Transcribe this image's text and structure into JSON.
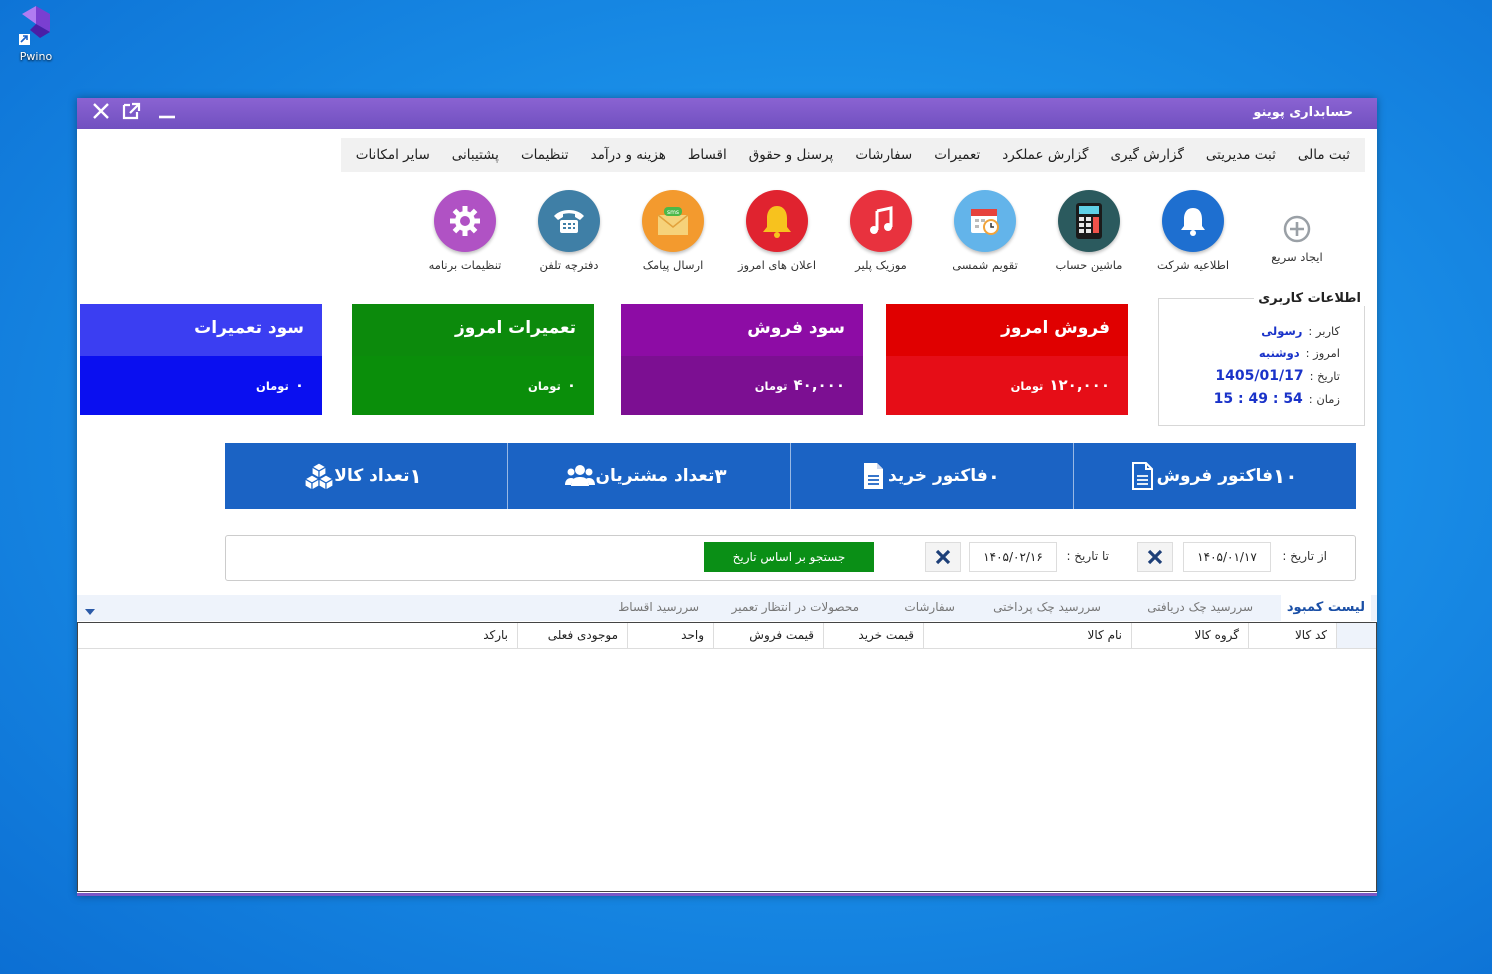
{
  "desktop": {
    "icon_label": "Pwino"
  },
  "window": {
    "title": "حسابداری پوینو"
  },
  "menu": [
    "ثبت مالی",
    "ثبت مدیریتی",
    "گزارش گیری",
    "گزارش عملکرد",
    "تعمیرات",
    "سفارشات",
    "پرسنل و حقوق",
    "اقساط",
    "هزینه و درآمد",
    "تنظیمات",
    "پشتیبانی",
    "سایر امکانات"
  ],
  "toolbar": [
    {
      "label": "ایجاد سریع",
      "icon": "plus-circle-icon",
      "color": "#9aa0a6"
    },
    {
      "label": "اطلاعیه شرکت",
      "icon": "bell-icon",
      "color": "#1e6fd0"
    },
    {
      "label": "ماشین حساب",
      "icon": "calculator-icon",
      "color": "#2b5a5e"
    },
    {
      "label": "تقویم شمسی",
      "icon": "calendar-icon",
      "color": "#63b4ea"
    },
    {
      "label": "موزیک پلیر",
      "icon": "music-note-icon",
      "color": "#e8323e"
    },
    {
      "label": "اعلان های امروز",
      "icon": "alarm-bell-icon",
      "color": "#e0232f"
    },
    {
      "label": "ارسال پیامک",
      "icon": "sms-envelope-icon",
      "color": "#f39a2e"
    },
    {
      "label": "دفترچه تلفن",
      "icon": "telephone-icon",
      "color": "#3f7fa6"
    },
    {
      "label": "تنظیمات برنامه",
      "icon": "gear-icon",
      "color": "#b052c4"
    }
  ],
  "user_info": {
    "title": "اطلاعات کاربری",
    "user_label": "کاربر :",
    "user": "رسولی",
    "day_label": "امروز :",
    "day": "دوشنبه",
    "date_label": "تاریخ :",
    "date": "1405/01/17",
    "time_label": "زمان :",
    "time": "15 : 49 : 54"
  },
  "cards": [
    {
      "title": "فروش امروز",
      "value": "۱۲۰,۰۰۰",
      "unit": "تومان",
      "color_top": "#e00000",
      "color_bottom": "#e60d17"
    },
    {
      "title": "سود فروش",
      "value": "۴۰,۰۰۰",
      "unit": "تومان",
      "color_top": "#8d0ca5",
      "color_bottom": "#7c0f92"
    },
    {
      "title": "تعمیرات امروز",
      "value": "۰",
      "unit": "تومان",
      "color_top": "#0c8a0c",
      "color_bottom": "#0a8e0a"
    },
    {
      "title": "سود تعمیرات",
      "value": "۰",
      "unit": "تومان",
      "color_top": "#3b3ef2",
      "color_bottom": "#0a0ff0"
    }
  ],
  "stats": [
    {
      "label": "فاکتور فروش",
      "value": "۱۰",
      "icon": "invoice-outline-icon"
    },
    {
      "label": "فاکتور خرید",
      "value": "۰",
      "icon": "document-icon"
    },
    {
      "label": "تعداد مشتریان",
      "value": "۳",
      "icon": "users-icon"
    },
    {
      "label": "تعداد کالا",
      "value": "۱",
      "icon": "boxes-icon"
    }
  ],
  "filter": {
    "from_label": "از تاریخ :",
    "from_value": "۱۴۰۵/۰۱/۱۷",
    "to_label": "تا تاریخ :",
    "to_value": "۱۴۰۵/۰۲/۱۶",
    "search_button": "جستجو بر اساس تاریخ"
  },
  "tabs": [
    "لیست کمبود",
    "سررسید چک دریافتی",
    "سررسید چک پرداختی",
    "سفارشات",
    "محصولات در انتظار تعمیر",
    "سررسید اقساط"
  ],
  "table": {
    "columns": [
      "کد کالا",
      "گروه کالا",
      "نام کالا",
      "قیمت خرید",
      "قیمت فروش",
      "واحد",
      "موجودی فعلی",
      "بارکد"
    ]
  }
}
